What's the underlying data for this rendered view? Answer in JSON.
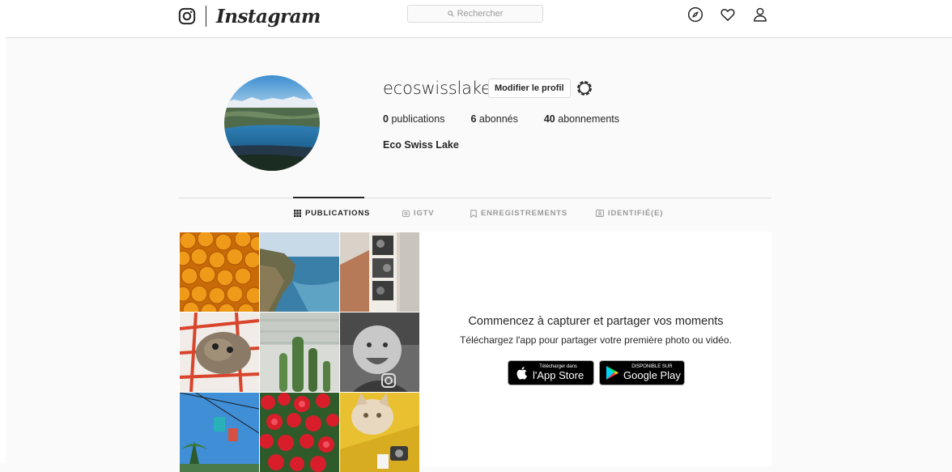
{
  "header": {
    "brand": "Instagram",
    "search_placeholder": "Rechercher"
  },
  "profile": {
    "username": "ecoswisslake",
    "edit_label": "Modifier le profil",
    "stats": {
      "posts_count": "0",
      "posts_label": "publications",
      "followers_count": "6",
      "followers_label": "abonnés",
      "following_count": "40",
      "following_label": "abonnements"
    },
    "full_name": "Eco Swiss Lake"
  },
  "tabs": [
    {
      "label": "PUBLICATIONS",
      "active": true
    },
    {
      "label": "IGTV",
      "active": false
    },
    {
      "label": "ENREGISTREMENTS",
      "active": false
    },
    {
      "label": "IDENTIFIÉ(E)",
      "active": false
    }
  ],
  "promo": {
    "title": "Commencez à capturer et partager vos moments",
    "subtitle": "Téléchargez l'app pour partager votre première photo ou vidéo.",
    "app_store_small": "Télécharger dans",
    "app_store_big": "l'App Store",
    "google_play_small": "DISPONIBLE SUR",
    "google_play_big": "Google Play"
  },
  "colors": {
    "border": "#dbdbdb",
    "text": "#262626",
    "muted": "#999999",
    "background": "#fafafa"
  }
}
